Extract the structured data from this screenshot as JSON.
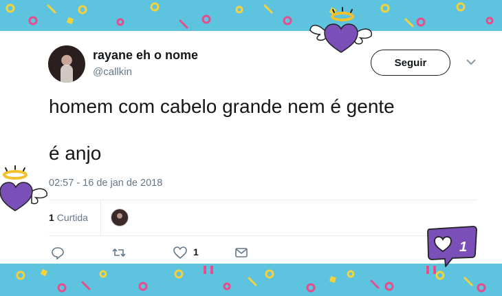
{
  "tweet": {
    "author_name": "rayane eh o nome",
    "handle": "@callkin",
    "follow_label": "Seguir",
    "text_line1": "homem com cabelo grande nem é gente",
    "text_line2": "é anjo",
    "timestamp": "02:57 - 16 de jan de 2018",
    "like_count": "1",
    "like_label": "Curtida",
    "action_like_count": "1"
  },
  "stickers": {
    "notification_badge_count": "1"
  },
  "colors": {
    "background": "#5ec3df",
    "heart_purple": "#7a4fb8",
    "halo_gold": "#f2c12e",
    "muted_text": "#657786"
  },
  "icons": [
    "chevron-down-icon",
    "reply-icon",
    "retweet-icon",
    "heart-icon",
    "direct-message-icon",
    "angel-heart-icon",
    "like-notification-icon"
  ]
}
